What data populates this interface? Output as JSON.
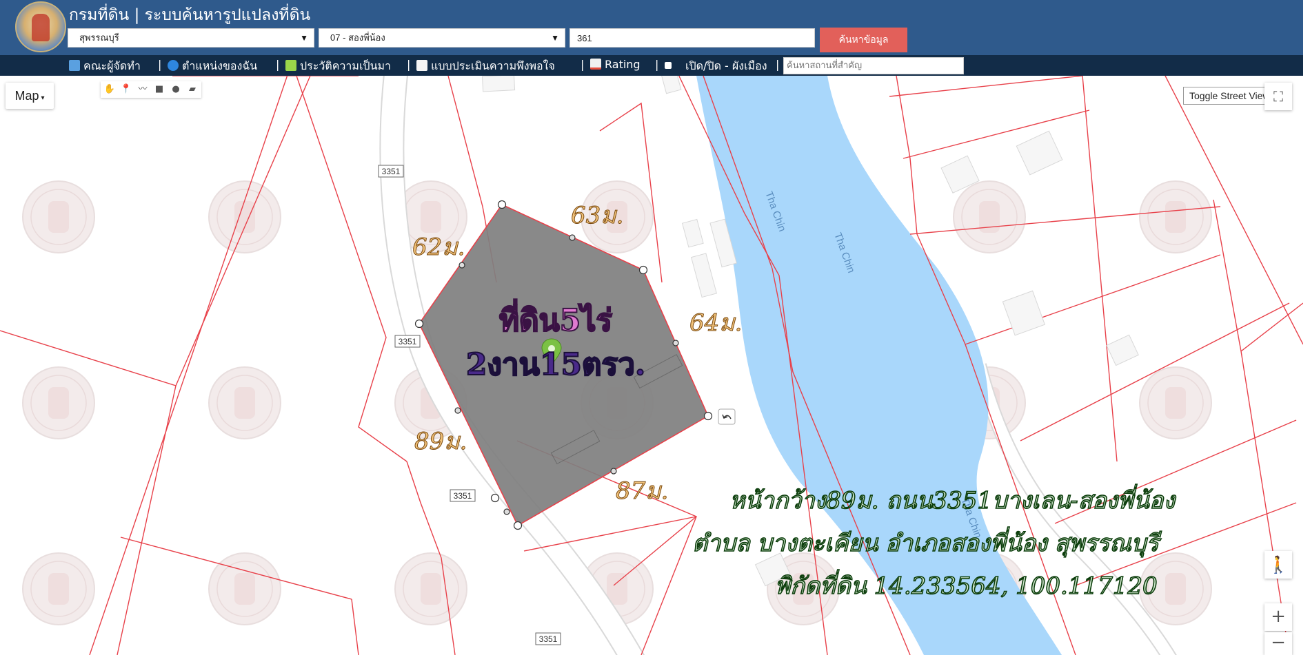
{
  "header": {
    "title": "กรมที่ดิน | ระบบค้นหารูปแปลงที่ดิน",
    "province_select": "สุพรรณบุรี",
    "district_select": "07 - สองพี่น้อง",
    "parcel_number": "361",
    "search_button": "ค้นหาข้อมูล"
  },
  "nav": {
    "items": [
      "คณะผู้จัดทำ",
      "ตำแหน่งของฉัน",
      "ประวัติความเป็นมา",
      "แบบประเมินความพึงพอใจ",
      "Rating",
      "เปิด/ปิด - ผังเมือง"
    ],
    "separator": "|",
    "search_placeholder": "ค้นหาสถานที่สำคัญ"
  },
  "map": {
    "map_type": "Map",
    "street_view_button": "Toggle Street View",
    "river_labels": [
      "Tha Chin",
      "Tha Chin",
      "Tha Chin"
    ],
    "road_labels": [
      "3351",
      "3351",
      "3351",
      "3351"
    ],
    "parcel_dimensions": [
      "63ม.",
      "62ม.",
      "64ม.",
      "89ม.",
      "87ม."
    ],
    "area_line1": "ที่ดิน5ไร่",
    "area_line2": "2งาน15ตรว.",
    "annotation_line1": "หน้ากว้าง89ม. ถนน3351บางเลน-สองพี่น้อง",
    "annotation_line2": "ตำบล บางตะเคียน อำเภอสองพี่น้อง สุพรรณบุรี",
    "annotation_line3": "พิกัดที่ดิน 14.233564, 100.117120",
    "zoom_in": "+",
    "zoom_out": "−",
    "colors": {
      "river": "#a9d7fb",
      "parcel_fill": "#7f7f7f",
      "parcel_line": "#e8414a",
      "area_text": "#e07ad0"
    }
  }
}
